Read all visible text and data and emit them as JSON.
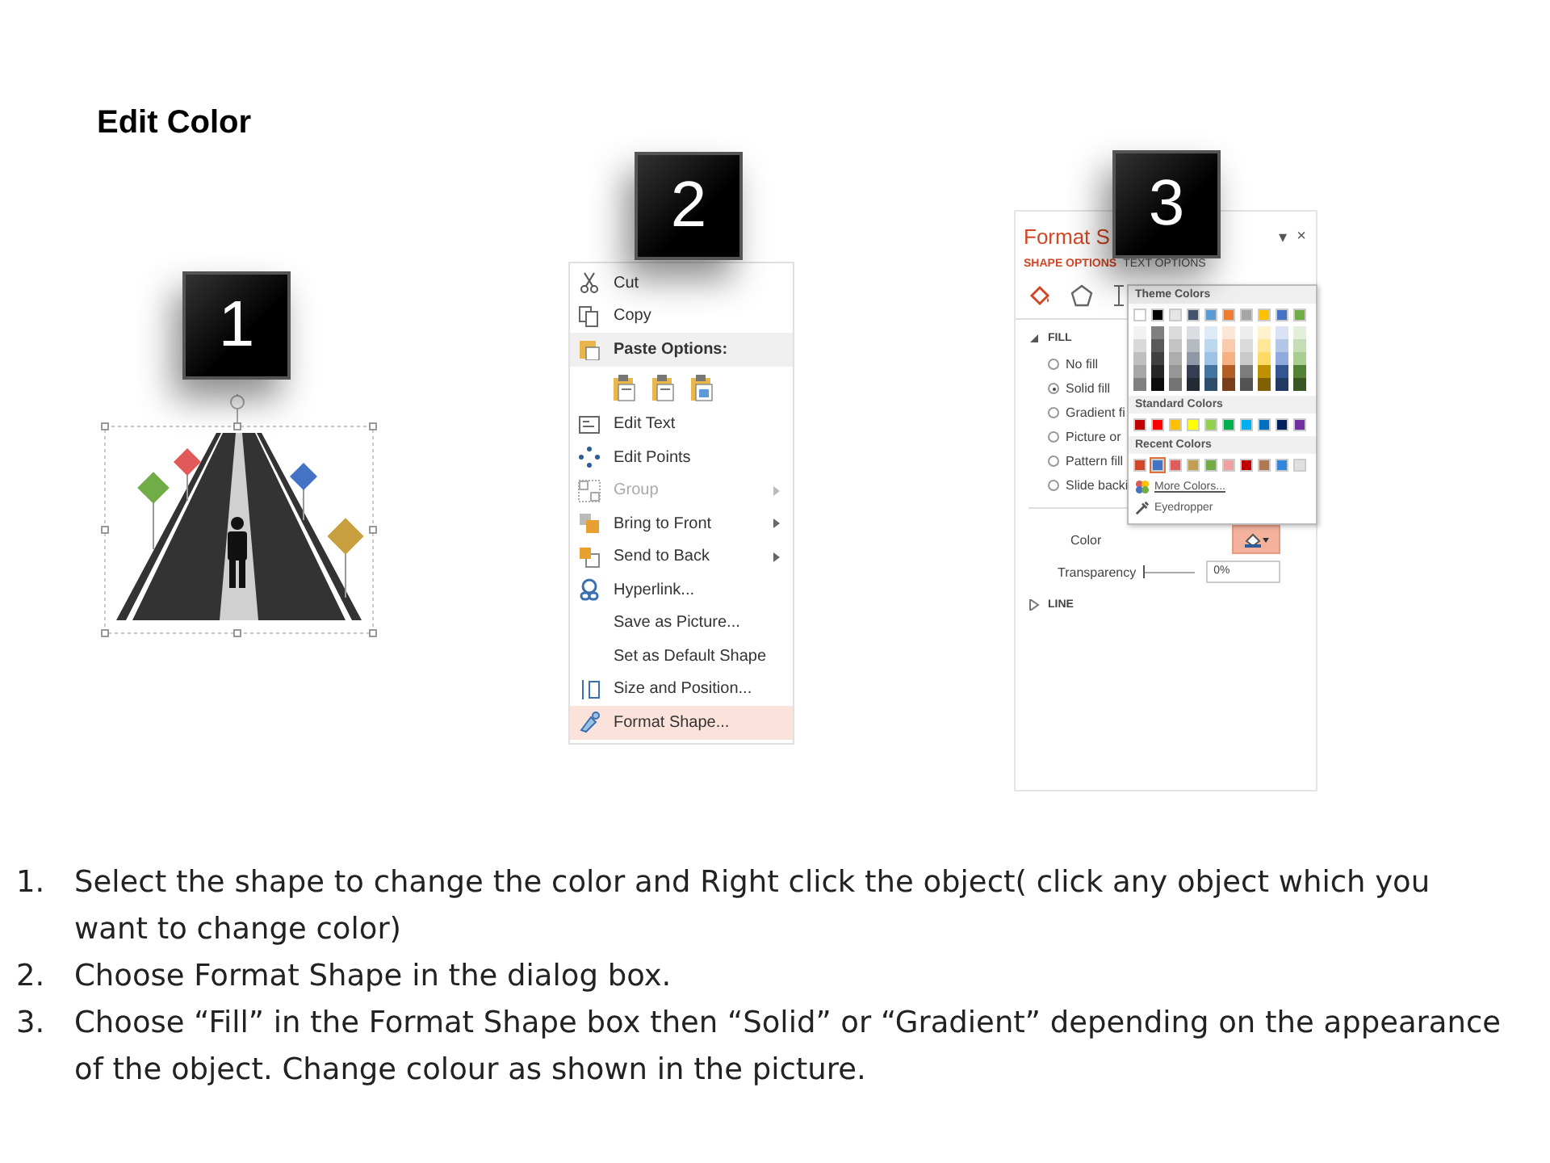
{
  "title": "Edit Color",
  "figure_1": {
    "badge": "1"
  },
  "context_menu": {
    "badge": "2",
    "items": [
      {
        "kind": "item",
        "label": "Cut",
        "disabled": false,
        "submenu": false,
        "selected": false
      },
      {
        "kind": "item",
        "label": "Copy",
        "disabled": false,
        "submenu": false,
        "selected": false
      },
      {
        "kind": "header",
        "label": "Paste Options:"
      },
      {
        "kind": "paste_icons"
      },
      {
        "kind": "item",
        "label": "Edit Text",
        "disabled": false,
        "submenu": false,
        "selected": false
      },
      {
        "kind": "item",
        "label": "Edit Points",
        "disabled": false,
        "submenu": false,
        "selected": false
      },
      {
        "kind": "item",
        "label": "Group",
        "disabled": true,
        "submenu": true,
        "selected": false
      },
      {
        "kind": "item",
        "label": "Bring to Front",
        "disabled": false,
        "submenu": true,
        "selected": false
      },
      {
        "kind": "item",
        "label": "Send to Back",
        "disabled": false,
        "submenu": true,
        "selected": false
      },
      {
        "kind": "item",
        "label": "Hyperlink...",
        "disabled": false,
        "submenu": false,
        "selected": false
      },
      {
        "kind": "item",
        "label": "Save as Picture...",
        "disabled": false,
        "submenu": false,
        "selected": false
      },
      {
        "kind": "item",
        "label": "Set as Default Shape",
        "disabled": false,
        "submenu": false,
        "selected": false
      },
      {
        "kind": "item",
        "label": "Size and Position...",
        "disabled": false,
        "submenu": false,
        "selected": false
      },
      {
        "kind": "item",
        "label": "Format Shape...",
        "disabled": false,
        "submenu": false,
        "selected": true
      }
    ]
  },
  "format_panel": {
    "badge": "3",
    "title": "Format S",
    "controls": [
      "▾",
      "×"
    ],
    "tabs": [
      {
        "label": "SHAPE OPTIONS",
        "selected": true
      },
      {
        "label": "TEXT OPTIONS",
        "selected": false
      }
    ],
    "fill_section": {
      "label": "FILL",
      "expanded": true
    },
    "options": [
      {
        "label": "No fill",
        "selected": false
      },
      {
        "label": "Solid fill",
        "selected": true
      },
      {
        "label": "Gradient fi",
        "selected": false
      },
      {
        "label": "Picture or",
        "selected": false
      },
      {
        "label": "Pattern fill",
        "selected": false
      },
      {
        "label": "Slide backi",
        "selected": false
      }
    ],
    "color_label": "Color",
    "transparency_label": "Transparency",
    "transparency_slider": {
      "level": 0
    },
    "transparency_value": "0%",
    "line_section": {
      "label": "LINE",
      "expanded": false
    },
    "palette": {
      "theme_header": "Theme Colors",
      "theme_colors": [
        {
          "color": "#ffffff"
        },
        {
          "color": "#000000"
        },
        {
          "color": "#e7e6e6"
        },
        {
          "color": "#44546a"
        },
        {
          "color": "#5b9bd5"
        },
        {
          "color": "#ed7d31"
        },
        {
          "color": "#a5a5a5"
        },
        {
          "color": "#ffc000"
        },
        {
          "color": "#4472c4"
        },
        {
          "color": "#70ad47"
        }
      ],
      "standard_header": "Standard Colors",
      "standard_colors": [
        {
          "color": "#c00000"
        },
        {
          "color": "#ff0000"
        },
        {
          "color": "#ffc000"
        },
        {
          "color": "#ffff00"
        },
        {
          "color": "#92d050"
        },
        {
          "color": "#00b050"
        },
        {
          "color": "#00b0f0"
        },
        {
          "color": "#0070c0"
        },
        {
          "color": "#002060"
        },
        {
          "color": "#7030a0"
        }
      ],
      "recent_header": "Recent Colors",
      "recent_colors": [
        {
          "color": "#d24726",
          "selected": false
        },
        {
          "color": "#4472c4",
          "selected": true
        },
        {
          "color": "#e05a5a",
          "selected": false
        },
        {
          "color": "#c0a050",
          "selected": false
        },
        {
          "color": "#70ad47",
          "selected": false
        },
        {
          "color": "#f0a0a0",
          "selected": false
        },
        {
          "color": "#c00000",
          "selected": false
        },
        {
          "color": "#b07850",
          "selected": false
        },
        {
          "color": "#2e86de",
          "selected": false
        },
        {
          "color": "#e0e0e0",
          "selected": false
        }
      ],
      "more_colors": "More Colors...",
      "eyedropper": "Eyedropper"
    }
  },
  "instructions": [
    {
      "number": "1.",
      "text": "Select the shape to change the color and Right click the object( click any object which you want to change color)"
    },
    {
      "number": "2.",
      "text": "Choose Format Shape in the dialog box."
    },
    {
      "number": "3.",
      "text": "Choose “Fill” in the Format Shape box then “Solid” or “Gradient” depending on the appearance of the object. Change colour as shown in the picture."
    }
  ]
}
